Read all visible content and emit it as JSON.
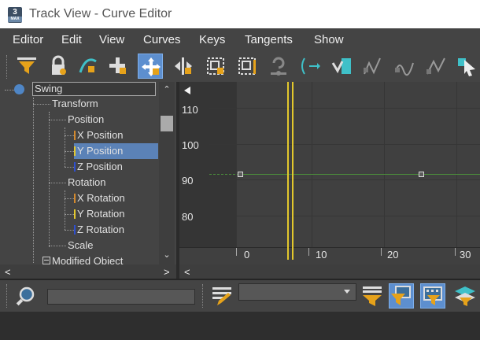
{
  "window": {
    "title": "Track View - Curve Editor",
    "app_icon_text": "3",
    "app_icon_sub": "MAX"
  },
  "menu": {
    "items": [
      "Editor",
      "Edit",
      "View",
      "Curves",
      "Keys",
      "Tangents",
      "Show"
    ]
  },
  "toolbar": {
    "icons": [
      "filter-icon",
      "lock-selection-icon",
      "snap-frames-icon",
      "add-keys-icon",
      "move-keys-icon",
      "slide-keys-icon",
      "scale-keys-icon",
      "scale-values-icon",
      "lock-handles-icon",
      "parameter-curve-out-of-range-icon",
      "freeform-icon",
      "reduce-keys-icon",
      "set-tangents-icon",
      "show-tangents-icon",
      "more-icon"
    ],
    "active": "move-keys-icon"
  },
  "tree": {
    "items": [
      {
        "label": "Swing"
      },
      {
        "label": "Transform"
      },
      {
        "label": "Position"
      },
      {
        "label": "X Position",
        "color": "#d48a2e"
      },
      {
        "label": "Y Position",
        "color": "#e3c82e",
        "selected": true
      },
      {
        "label": "Z Position",
        "color": "#2f4fd0"
      },
      {
        "label": "Rotation"
      },
      {
        "label": "X Rotation",
        "color": "#d48a2e"
      },
      {
        "label": "Y Rotation",
        "color": "#e3c82e"
      },
      {
        "label": "Z Rotation",
        "color": "#2f4fd0"
      },
      {
        "label": "Scale"
      },
      {
        "label": "Modified Object"
      }
    ]
  },
  "graph": {
    "y_ticks": [
      "110",
      "100",
      "90",
      "80"
    ],
    "x_ticks": [
      "0",
      "10",
      "20",
      "30"
    ],
    "curve_value": 92,
    "key_frames": [
      0,
      25
    ],
    "time_slider_frame": 6.5,
    "curve_color": "#4b8f3b",
    "time_color": "#e2c72c"
  },
  "colors": {
    "accent": "#5d8fcf",
    "selection": "#5b82b7"
  }
}
